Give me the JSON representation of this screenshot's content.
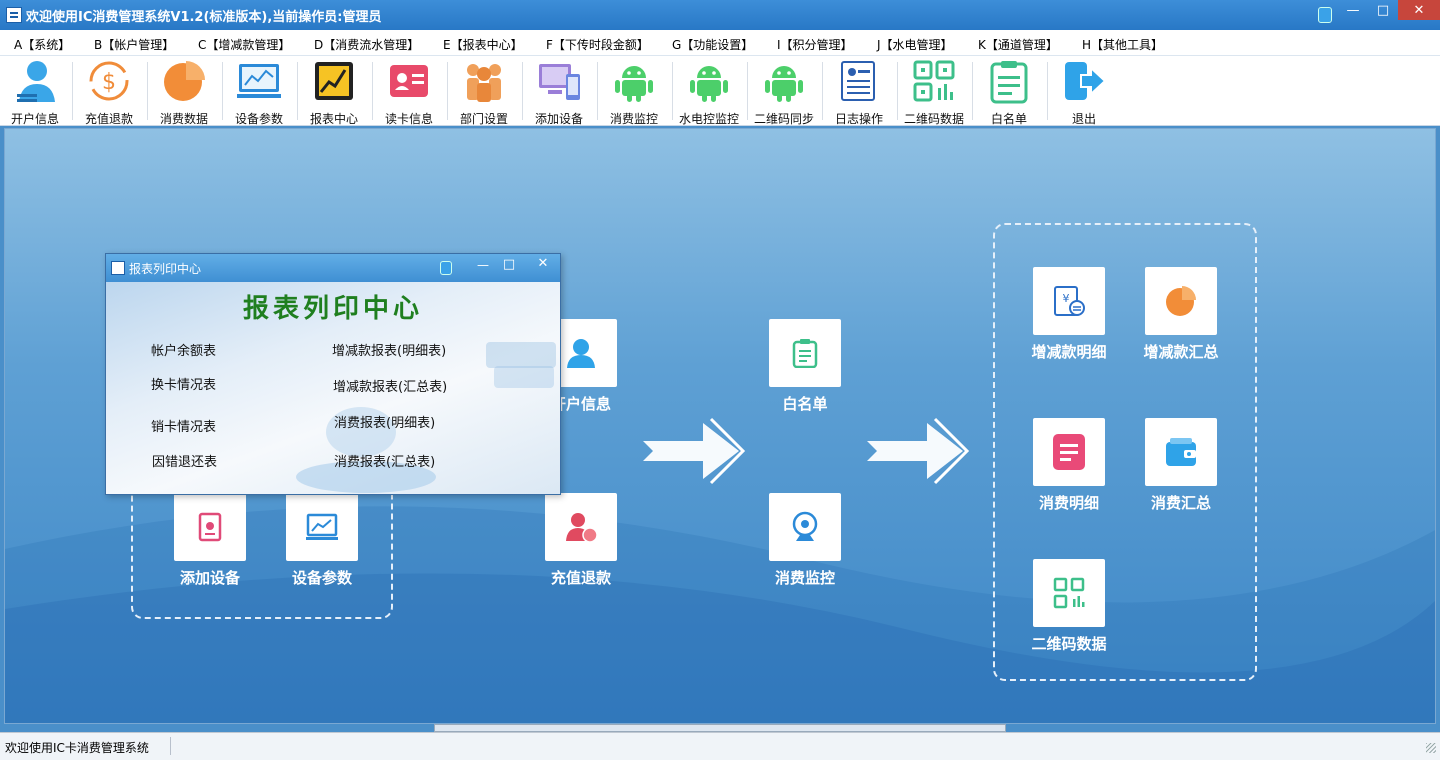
{
  "app": {
    "title": "欢迎使用IC消费管理系统V1.2(标准版本),当前操作员:管理员"
  },
  "menu": [
    "A【系统】",
    "B【帐户管理】",
    "C【增减款管理】",
    "D【消费流水管理】",
    "E【报表中心】",
    "F【下传时段金额】",
    "G【功能设置】",
    "I【积分管理】",
    "J【水电管理】",
    "K【通道管理】",
    "H【其他工具】"
  ],
  "toolbar": [
    "开户信息",
    "充值退款",
    "消费数据",
    "设备参数",
    "报表中心",
    "读卡信息",
    "部门设置",
    "添加设备",
    "消费监控",
    "水电控监控",
    "二维码同步",
    "日志操作",
    "二维码数据",
    "白名单",
    "退出"
  ],
  "flow": {
    "add_device": "添加设备",
    "device_params": "设备参数",
    "open_account": "开户信息",
    "recharge": "充值退款",
    "whitelist": "白名单",
    "consume_monitor": "消费监控",
    "inc_detail": "增减款明细",
    "inc_summary": "增减款汇总",
    "consume_detail": "消费明细",
    "consume_summary": "消费汇总",
    "qr_data": "二维码数据"
  },
  "dialog": {
    "title": "报表列印中心",
    "heading": "报表列印中心",
    "left": [
      "帐户余额表",
      "换卡情况表",
      "销卡情况表",
      "因错退还表"
    ],
    "right": [
      "增减款报表(明细表)",
      "增减款报表(汇总表)",
      "消费报表(明细表)",
      "消费报表(汇总表)"
    ]
  },
  "status": {
    "text": "欢迎使用IC卡消费管理系统"
  }
}
